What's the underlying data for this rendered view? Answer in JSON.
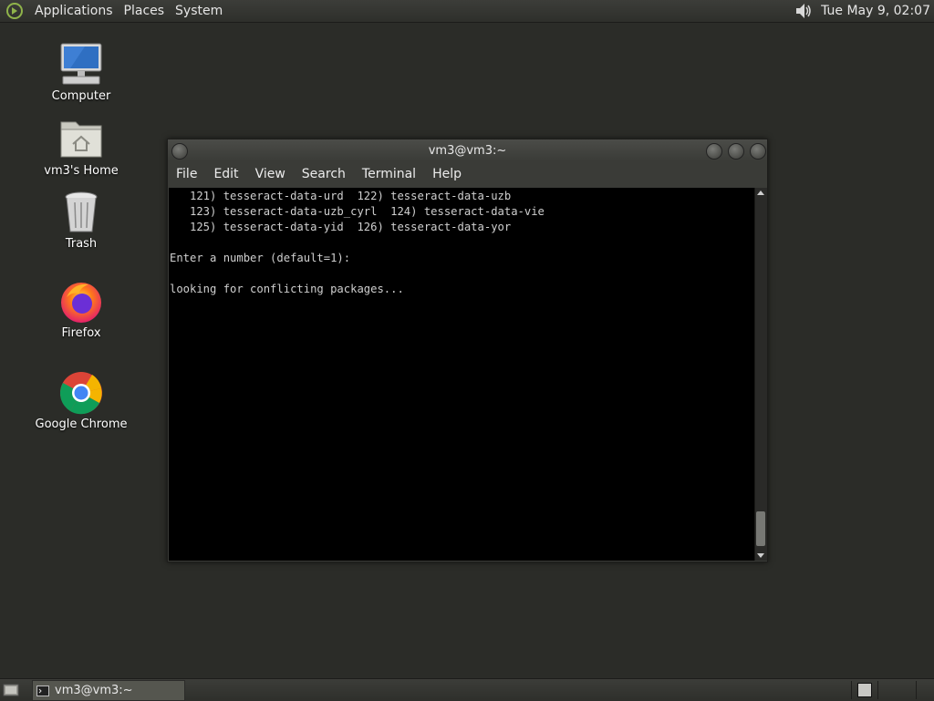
{
  "top_panel": {
    "menus": [
      "Applications",
      "Places",
      "System"
    ],
    "clock": "Tue May  9, 02:07"
  },
  "desktop_icons": [
    {
      "label": "Computer",
      "icon": "computer-icon"
    },
    {
      "label": "vm3's Home",
      "icon": "home-folder-icon"
    },
    {
      "label": "Trash",
      "icon": "trash-icon"
    },
    {
      "label": "Firefox",
      "icon": "firefox-icon"
    },
    {
      "label": "Google Chrome",
      "icon": "chrome-icon"
    }
  ],
  "terminal": {
    "title": "vm3@vm3:~",
    "menus": [
      "File",
      "Edit",
      "View",
      "Search",
      "Terminal",
      "Help"
    ],
    "output": "   121) tesseract-data-urd  122) tesseract-data-uzb\n   123) tesseract-data-uzb_cyrl  124) tesseract-data-vie\n   125) tesseract-data-yid  126) tesseract-data-yor\n\nEnter a number (default=1):\n\nlooking for conflicting packages..."
  },
  "bottom_panel": {
    "task_label": "vm3@vm3:~"
  },
  "colors": {
    "desktop_bg": "#2b2c28",
    "panel_bg": "#3c3d39",
    "terminal_bg": "#000000",
    "terminal_fg": "#cfcfcf"
  }
}
